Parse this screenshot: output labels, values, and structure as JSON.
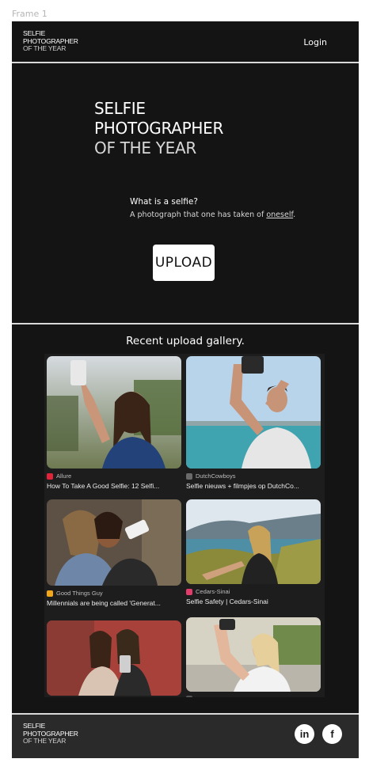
{
  "canvas": {
    "frame_label": "Frame 1"
  },
  "brand": {
    "line1": "SELFIE",
    "line2": "PHOTOGRAPHER",
    "line3": "OF THE YEAR"
  },
  "header": {
    "login_label": "Login"
  },
  "hero": {
    "title_line1": "SELFIE",
    "title_line2": "PHOTOGRAPHER",
    "title_line3": "OF THE YEAR",
    "question": "What is a selfie?",
    "answer_prefix": "A photograph that one has taken of ",
    "answer_link": "oneself",
    "answer_suffix": ".",
    "upload_label": "UPLOAD"
  },
  "gallery": {
    "title": "Recent upload gallery.",
    "items": [
      {
        "source": "Allure",
        "title": "How To Take A Good Selfie: 12 Selfi...",
        "fav_color": "#e0243a"
      },
      {
        "source": "DutchCowboys",
        "title": "Selfie nieuws + filmpjes op DutchCo...",
        "fav_color": "#6a6a6a"
      },
      {
        "source": "Good Things Guy",
        "title": "Millennials are being called 'Generat...",
        "fav_color": "#f2a71b"
      },
      {
        "source": "Cedars-Sinai",
        "title": "Selfie Safety | Cedars-Sinai",
        "fav_color": "#e23d6a"
      },
      {
        "source": "",
        "title": "",
        "fav_color": "#555555"
      },
      {
        "source": "",
        "title": "",
        "fav_color": "#555555"
      }
    ]
  },
  "footer": {
    "linkedin_label": "in",
    "facebook_label": "f"
  }
}
